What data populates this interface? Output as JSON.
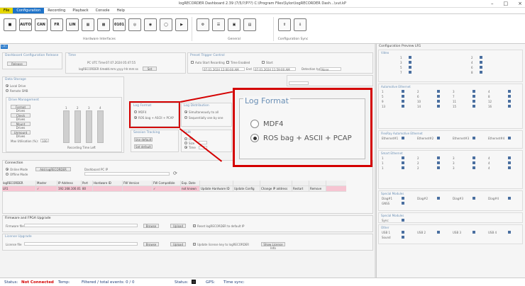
{
  "window": {
    "title": "logRECORDER Dashboard 2.39 (7/5/?/P??) C:\\Program Files\\Sylon\\logRECORDER Dash...\\vut.kP"
  },
  "menu": {
    "file": "File",
    "items": [
      "Configuration",
      "Recording",
      "Playback",
      "Console",
      "Help"
    ]
  },
  "ribbon": {
    "icons": [
      "camera-icon",
      "automotive-ethernet-icon",
      "can-icon",
      "flexray-icon",
      "lin-icon",
      "network-icon",
      "ethernet-icon",
      "serial-icon",
      "gps-icon",
      "sensor-icon",
      "lidar-icon",
      "audio-icon",
      "settings-icon",
      "storage-icon",
      "message-icon",
      "notes-icon",
      "upload-icon",
      "download-icon"
    ],
    "icon_labels": {
      "automotive": "AUTO",
      "can": "CAN",
      "flexray": "FR",
      "lin": "LIN",
      "serial": "0101"
    },
    "groups": [
      "Hardware Interfaces",
      "General",
      "Configuration Sync"
    ]
  },
  "tab": {
    "label": "LR1"
  },
  "dashboard": {
    "config_release_title": "Dashboard Configuration Release",
    "release_button": "Release",
    "time_title": "Time",
    "pc_utc_label": "PC UTC Time",
    "pc_utc_value": "07.07.2024 05:47:55",
    "logrecorder_time_label": "logRECORDER time",
    "logrecorder_time_value": "dd.mm.yyyy hh:mm:ss",
    "set_button": "Set",
    "preset_title": "Preset Trigger Control",
    "auto_start_label": "Auto Start Recording",
    "time_enabled_label": "Time Enabled",
    "start_label": "Start",
    "end_label": "End",
    "start_value": "07.01.2024 12:00:00 AM",
    "end_value": "07.01.2024 11:59:00 AM",
    "detection_type_label": "Detection type",
    "detection_type_value": "None",
    "data_storage_title": "Data Storage",
    "local_drive": "Local Drive",
    "remote_share": "Remote SMB",
    "drive_mgmt_title": "Drive Management",
    "drive_buttons": [
      "Format Drives",
      "Check Drives",
      "Mount Drives",
      "Unmount Drives"
    ],
    "max_util_label": "Max Utilisation (%):",
    "max_util_value": "100",
    "drive_numbers": [
      "1",
      "2",
      "3",
      "4"
    ],
    "recording_time_left": "Recording Time Left",
    "log_format_title": "Log Format",
    "log_format_options": [
      "MDF4",
      "ROS bag + ASCII + PCAP"
    ],
    "log_distribution_title": "Log Distribution",
    "log_dist_options": [
      "Simultaneously to all",
      "Sequentially one by one"
    ],
    "session_tracking_title": "Session Tracking",
    "use_default": "Use default",
    "set_default": "Set default",
    "split_title": "Split",
    "split_off": "Off",
    "split_size": "Size",
    "split_time": "Time",
    "connection_title": "Connection",
    "online_mode": "Online Mode",
    "offline_mode": "Offline Mode",
    "add_button": "Add logRECORDER",
    "dashboard_pc_ip_label": "Dashboard PC IP",
    "table_headers": [
      "logRECORDER",
      "Master",
      "IP Address",
      "Port",
      "Hardware ID",
      "FW Version",
      "FW Compatible",
      "Exp. Date",
      "",
      "",
      "",
      "",
      ""
    ],
    "table_row": [
      "LR1",
      "",
      "192.168.100.01",
      "80",
      "",
      "",
      "",
      "not known",
      "Update Hardware ID",
      "Update Config",
      "Change IP address",
      "Restart",
      "Remove"
    ],
    "firmware_title": "Firmware and FPGA Upgrade",
    "firmware_file_label": "Firmware file",
    "browse_button": "Browse",
    "upload_button": "Upload",
    "reset_check_label": "Reset logRECORDER to default IP",
    "license_title": "License Upgrade",
    "license_file_label": "License file",
    "license_check_label": "Update license key to logRECORDER",
    "show_license_button": "Show License Info"
  },
  "zoom": {
    "title": "Log Format",
    "options": [
      "MDF4",
      "ROS bag + ASCII + PCAP"
    ]
  },
  "config_preview": {
    "title": "Configuration Preview LR1",
    "sections": [
      {
        "name": "Video",
        "rows": [
          [
            "1",
            "2"
          ],
          [
            "3",
            "4"
          ],
          [
            "5",
            "6"
          ],
          [
            "7",
            "8"
          ]
        ]
      },
      {
        "name": "Automotive Ethernet",
        "rows": [
          [
            "1",
            "2",
            "3",
            "4"
          ],
          [
            "5",
            "6",
            "7",
            "8"
          ],
          [
            "9",
            "10",
            "11",
            "12"
          ],
          [
            "13",
            "14",
            "15",
            "16"
          ]
        ]
      },
      {
        "name": "FlexRay Automotive Ethernet",
        "rows": [
          [
            "Ethernet#1",
            "Ethernet#2",
            "Ethernet#3",
            "Ethernet#4"
          ]
        ]
      },
      {
        "name": "Smart Ethernet",
        "rows": [
          [
            "1",
            "2",
            "3",
            "4"
          ],
          [
            "1",
            "2",
            "3",
            "4"
          ],
          [
            "1",
            "2",
            "3",
            "4"
          ]
        ]
      },
      {
        "name": "Special Modules",
        "rows": [
          [
            "Diag#1",
            "Diag#2",
            "Diag#3",
            "Diag#4"
          ],
          [
            "GNSS"
          ]
        ]
      },
      {
        "name": "Special Modules",
        "rows": [
          [
            "Sync"
          ]
        ]
      },
      {
        "name": "Other",
        "rows": [
          [
            "USB 1",
            "USB 2",
            "USB 3",
            "USB 4"
          ],
          [
            "Sound"
          ]
        ]
      }
    ]
  },
  "status": {
    "status_label": "Status:",
    "status_value": "Not Connected",
    "temp_label": "Temp:",
    "events_label": "Filtered / total events: 0 / 0",
    "status2_label": "Status:",
    "gps_label": "GPS:",
    "time_sync_label": "Time sync:"
  },
  "colors": {
    "accent": "#1f73c8",
    "highlight": "#d40000",
    "file_menu": "#e6d800",
    "selected_row": "#f6c5d2"
  }
}
